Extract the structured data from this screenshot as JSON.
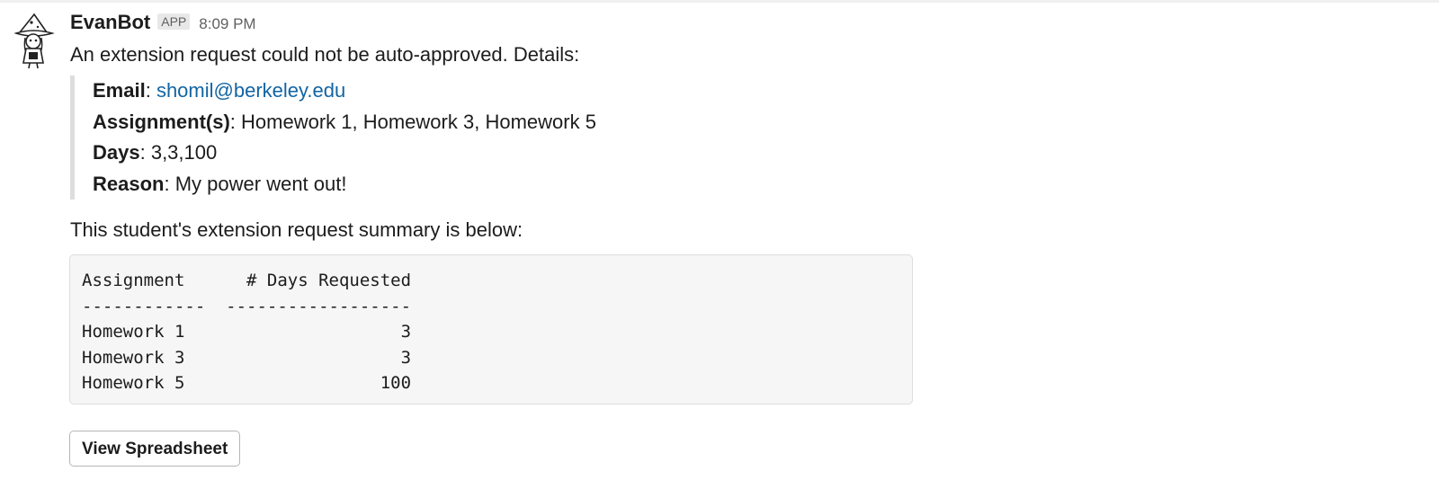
{
  "message": {
    "sender": "EvanBot",
    "badge": "APP",
    "timestamp": "8:09 PM",
    "intro": "An extension request could not be auto-approved. Details:",
    "details": {
      "email_label": "Email",
      "email_value": "shomil@berkeley.edu",
      "assignments_label": "Assignment(s)",
      "assignments_value": "Homework 1, Homework 3, Homework 5",
      "days_label": "Days",
      "days_value": "3,3,100",
      "reason_label": "Reason",
      "reason_value": "My power went out!"
    },
    "summary_intro": "This student's extension request summary is below:",
    "summary_table": {
      "header_col1": "Assignment",
      "header_col2": "# Days Requested",
      "separator_col1": "------------",
      "separator_col2": "------------------",
      "rows": [
        {
          "assignment": "Homework 1",
          "days": "3"
        },
        {
          "assignment": "Homework 3",
          "days": "3"
        },
        {
          "assignment": "Homework 5",
          "days": "100"
        }
      ]
    },
    "button_label": "View Spreadsheet"
  },
  "icons": {
    "avatar": "bot-wizard-avatar-icon"
  },
  "colors": {
    "link": "#1264a3",
    "quote_bar": "#dddddd",
    "code_bg": "#f6f6f6",
    "badge_bg": "#e8e8e8",
    "text": "#1d1c1d",
    "muted": "#616061"
  }
}
